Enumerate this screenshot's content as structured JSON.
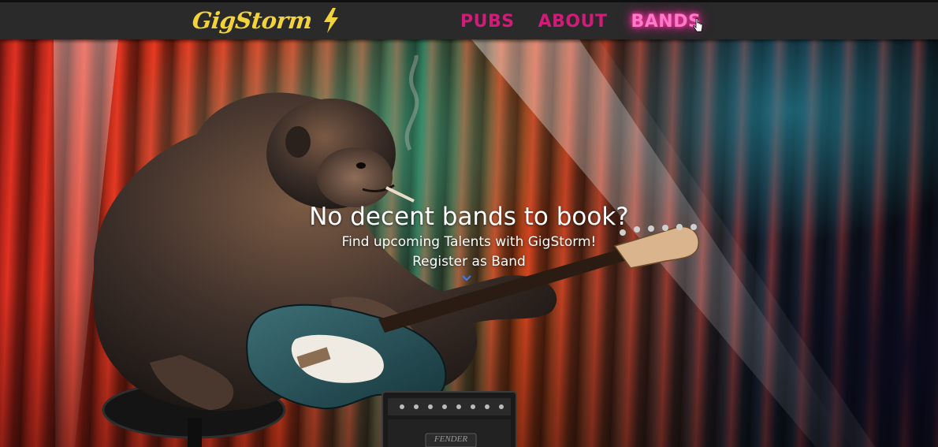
{
  "header": {
    "logo_text": "GigStorm",
    "logo_icon": "lightning-bolt-icon",
    "nav": [
      {
        "label": "PUBS"
      },
      {
        "label": "ABOUT"
      },
      {
        "label": "BANDS"
      }
    ],
    "active_nav": "BANDS"
  },
  "hero": {
    "title": "No decent bands to book?",
    "subtitle": "Find upcoming Talents with GigStorm!",
    "cta_label": "Register as Band",
    "scroll_icon": "chevron-down-icon",
    "amp_brand": "FENDER"
  },
  "colors": {
    "topbar": "#2a2a2a",
    "logo": "#f2d33a",
    "nav": "#d01c78",
    "nav_active_glow": "#ff2ea0",
    "hero_text": "#ffffff"
  }
}
